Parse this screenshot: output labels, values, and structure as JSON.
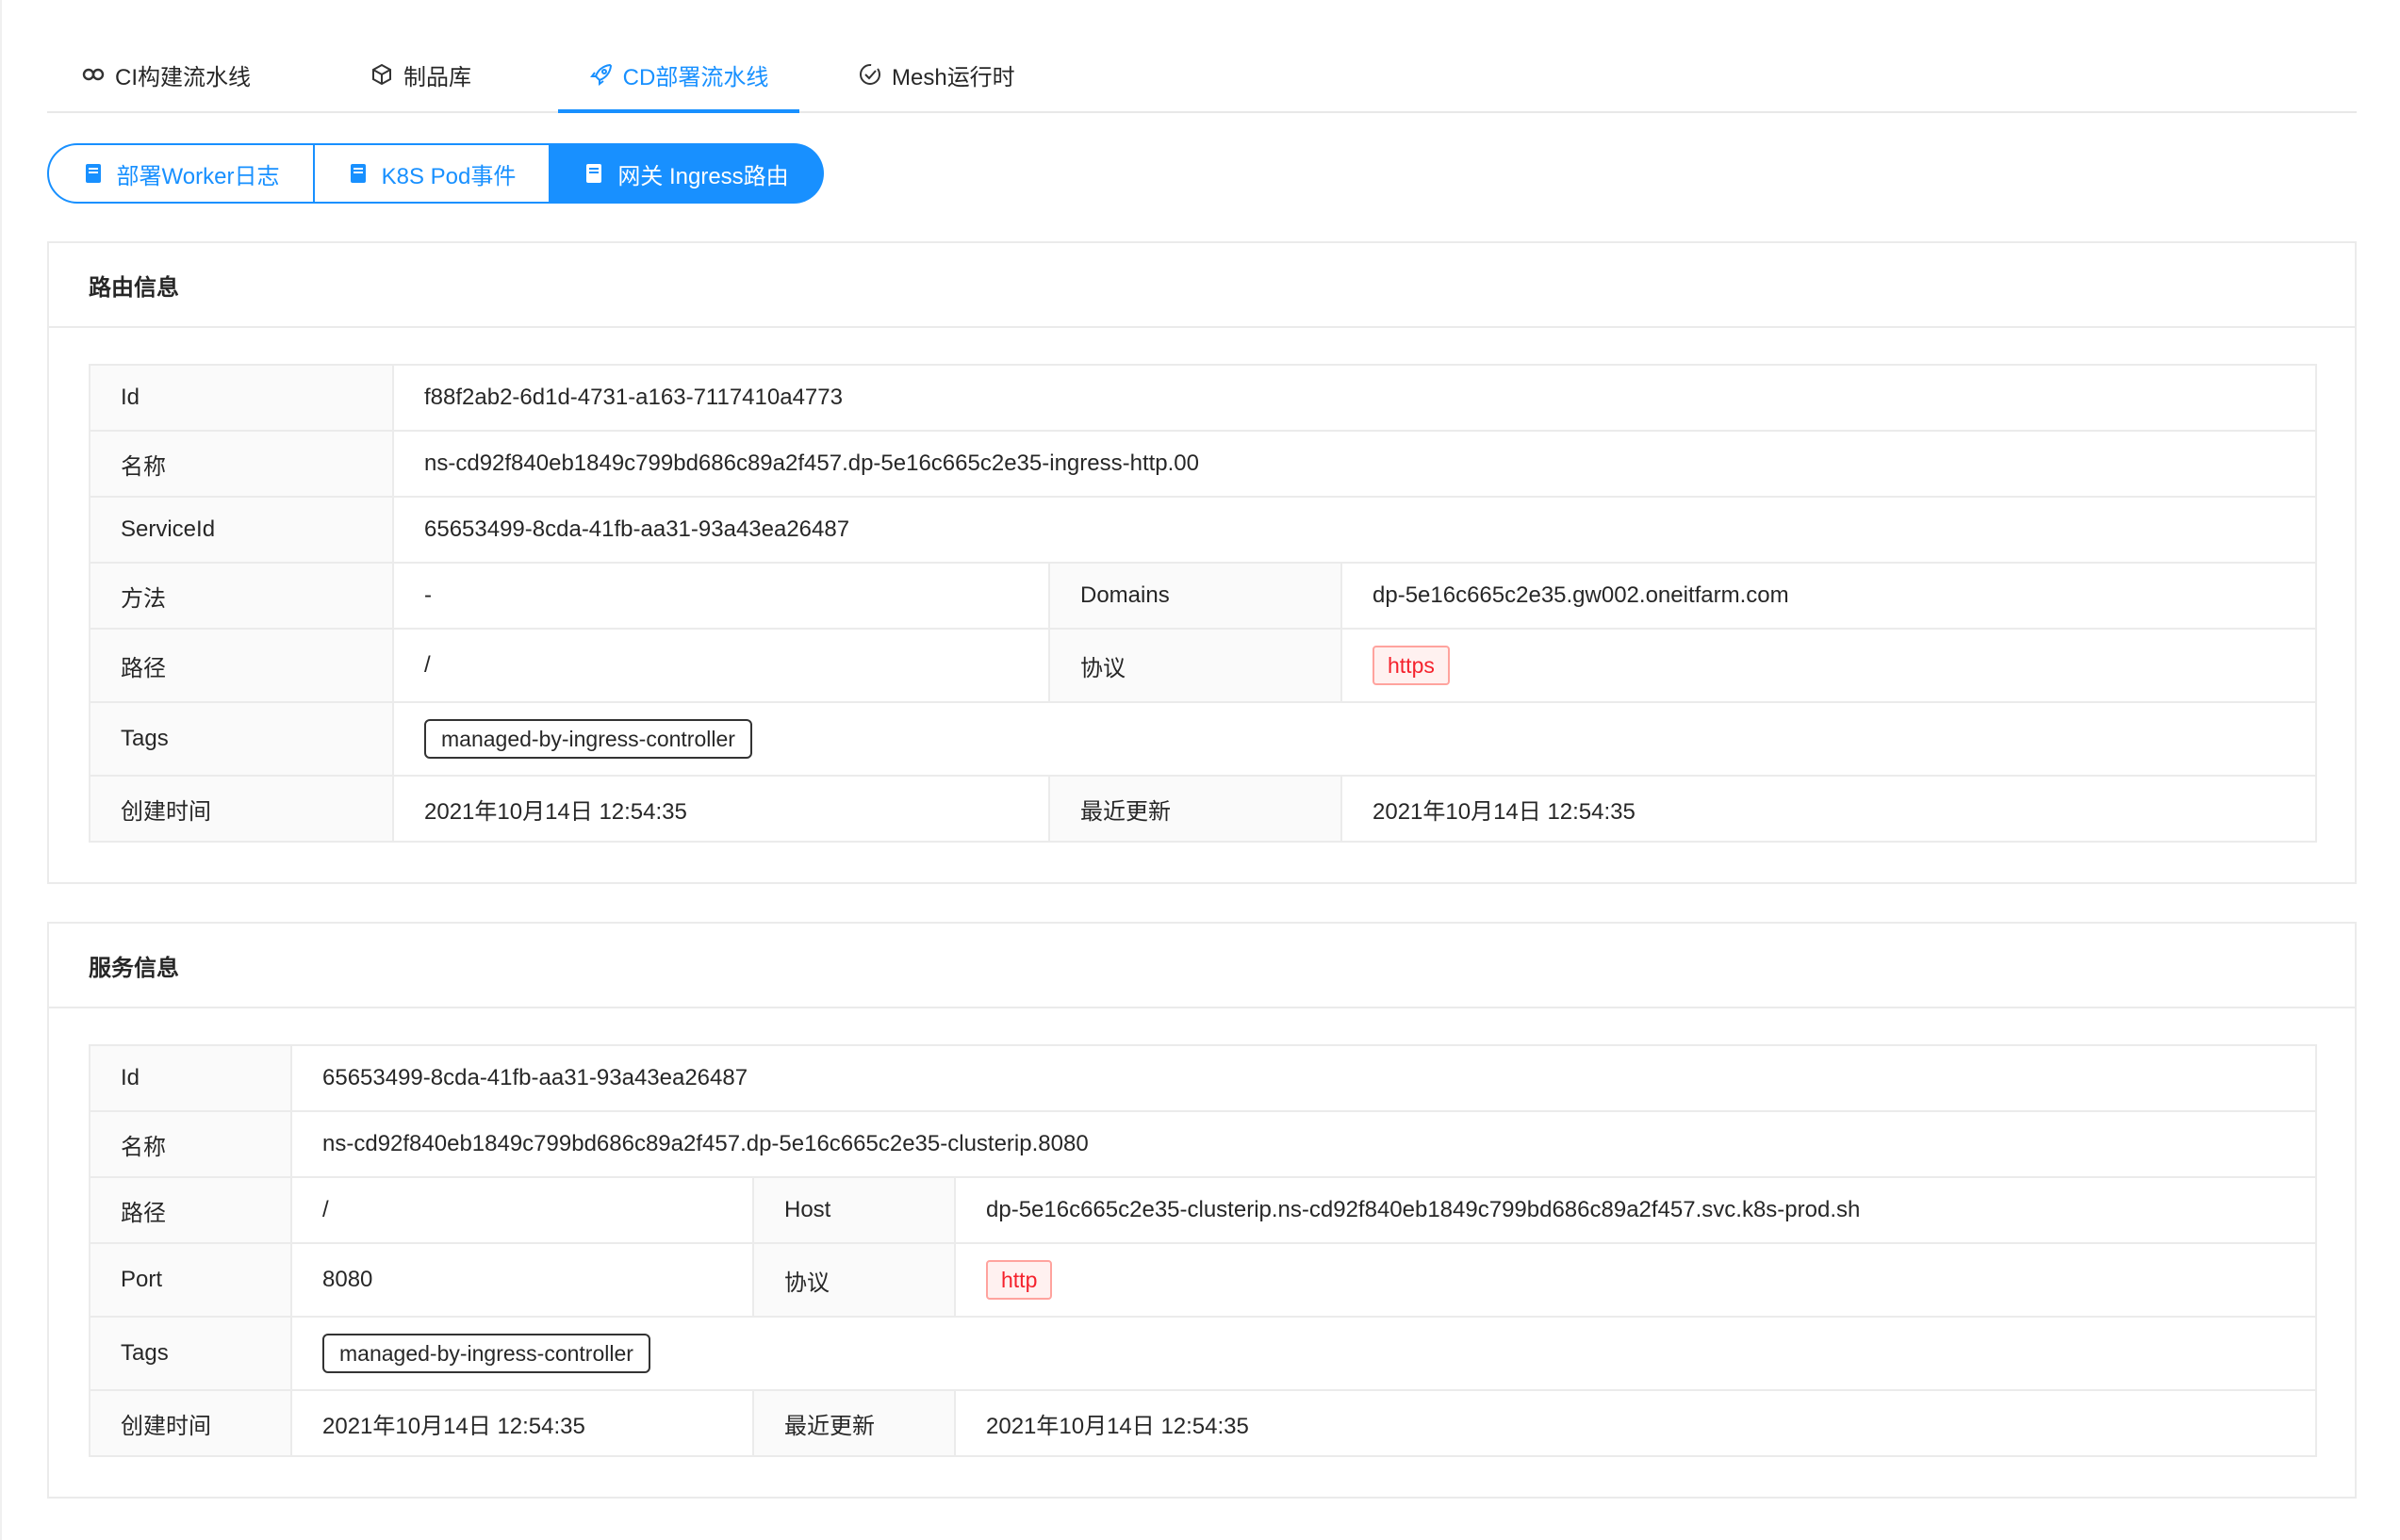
{
  "top_tabs": [
    {
      "label": "CI构建流水线",
      "icon": "cloud-link-icon",
      "active": false
    },
    {
      "label": "制品库",
      "icon": "cube-icon",
      "active": false
    },
    {
      "label": "CD部署流水线",
      "icon": "rocket-icon",
      "active": true
    },
    {
      "label": "Mesh运行时",
      "icon": "check-circle-icon",
      "active": false
    }
  ],
  "segments": [
    {
      "label": "部署Worker日志",
      "icon": "book-icon",
      "active": false
    },
    {
      "label": "K8S Pod事件",
      "icon": "book-icon",
      "active": false
    },
    {
      "label": "网关 Ingress路由",
      "icon": "book-icon",
      "active": true
    }
  ],
  "route": {
    "title": "路由信息",
    "id_label": "Id",
    "id_value": "f88f2ab2-6d1d-4731-a163-7117410a4773",
    "name_label": "名称",
    "name_value": "ns-cd92f840eb1849c799bd686c89a2f457.dp-5e16c665c2e35-ingress-http.00",
    "service_id_label": "ServiceId",
    "service_id_value": "65653499-8cda-41fb-aa31-93a43ea26487",
    "method_label": "方法",
    "method_value": "-",
    "domains_label": "Domains",
    "domains_value": "dp-5e16c665c2e35.gw002.oneitfarm.com",
    "path_label": "路径",
    "path_value": "/",
    "protocol_label": "协议",
    "protocol_value": "https",
    "tags_label": "Tags",
    "tags_value": "managed-by-ingress-controller",
    "created_label": "创建时间",
    "created_value": "2021年10月14日 12:54:35",
    "updated_label": "最近更新",
    "updated_value": "2021年10月14日 12:54:35"
  },
  "service": {
    "title": "服务信息",
    "id_label": "Id",
    "id_value": "65653499-8cda-41fb-aa31-93a43ea26487",
    "name_label": "名称",
    "name_value": "ns-cd92f840eb1849c799bd686c89a2f457.dp-5e16c665c2e35-clusterip.8080",
    "path_label": "路径",
    "path_value": "/",
    "host_label": "Host",
    "host_value": "dp-5e16c665c2e35-clusterip.ns-cd92f840eb1849c799bd686c89a2f457.svc.k8s-prod.sh",
    "port_label": "Port",
    "port_value": "8080",
    "protocol_label": "协议",
    "protocol_value": "http",
    "tags_label": "Tags",
    "tags_value": "managed-by-ingress-controller",
    "created_label": "创建时间",
    "created_value": "2021年10月14日 12:54:35",
    "updated_label": "最近更新",
    "updated_value": "2021年10月14日 12:54:35"
  },
  "colors": {
    "primary": "#1890ff",
    "tag_red": "#f5222d",
    "border": "#ebebeb"
  }
}
